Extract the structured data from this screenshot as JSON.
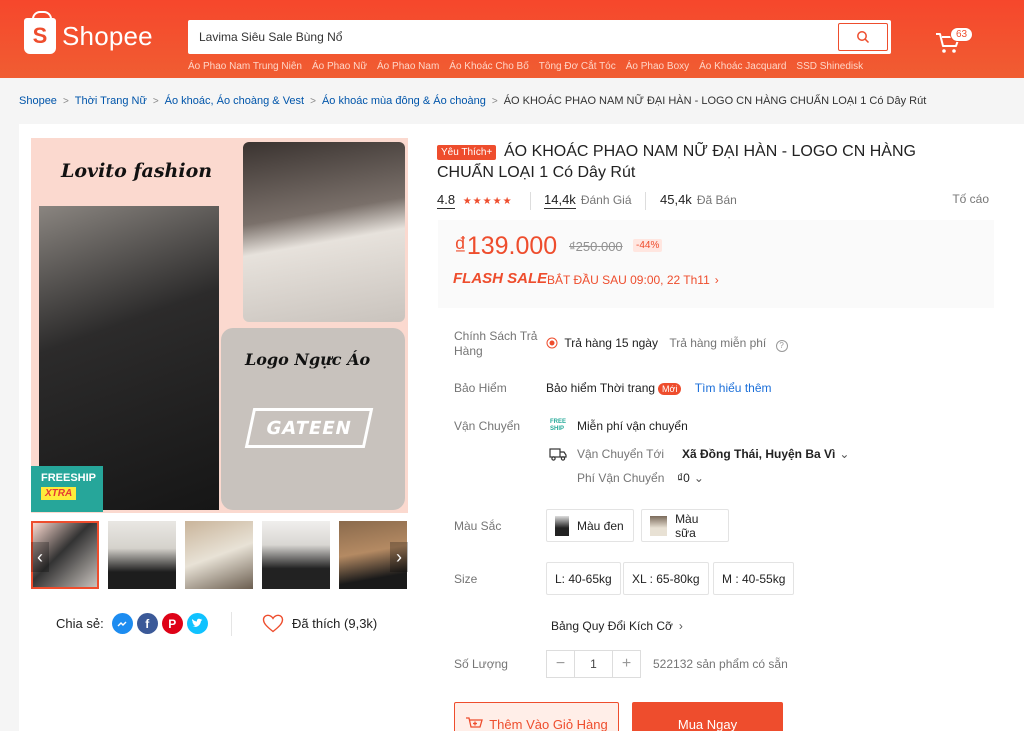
{
  "header": {
    "logo_text": "Shopee",
    "logo_mark": "S",
    "search_value": "Lavima Siêu Sale Bùng Nổ",
    "suggestions": [
      "Áo Phao Nam Trung Niên",
      "Áo Phao Nữ",
      "Áo Phao Nam",
      "Áo Khoác Cho Bố",
      "Tông Đơ Cắt Tóc",
      "Áo Phao Boxy",
      "Áo Khoác Jacquard",
      "SSD Shinedisk"
    ],
    "cart_count": "63",
    "brand_color": "#ee4d2d"
  },
  "breadcrumb": {
    "items": [
      "Shopee",
      "Thời Trang Nữ",
      "Áo khoác, Áo choàng & Vest",
      "Áo khoác mùa đông & Áo choàng"
    ],
    "current": "ÁO KHOÁC PHAO NAM NỮ ĐẠI HÀN - LOGO CN HÀNG CHUẨN LOẠI 1 Có Dây Rút"
  },
  "gallery": {
    "main_title": "Lovito fashion",
    "logo_title": "Logo Ngực Áo",
    "logo_box": "GATEEN",
    "freeship": "FREESHIP",
    "freeship_xtra": "XTRA"
  },
  "share": {
    "label": "Chia sẻ:",
    "icons": [
      "messenger-icon",
      "facebook-icon",
      "pinterest-icon",
      "twitter-icon"
    ],
    "liked": "Đã thích (9,3k)"
  },
  "product": {
    "badge": "Yêu Thích+",
    "title": "ÁO KHOÁC PHAO NAM NỮ ĐẠI HÀN - LOGO CN HÀNG CHUẨN LOẠI 1 Có Dây Rút",
    "rating": "4.8",
    "stars": "★★★★★",
    "reviews_count": "14,4k",
    "reviews_label": "Đánh Giá",
    "sold_count": "45,4k",
    "sold_label": "Đã Bán",
    "report": "Tố cáo",
    "price": "₫139.000",
    "old_price": "₫250.000",
    "discount": "-44%",
    "flash_sale": "FLASH SALE",
    "flash_time": "BẮT ĐẦU SAU 09:00, 22 Th11"
  },
  "details": {
    "return_label": "Chính Sách Trả Hàng",
    "return_value": "Trả hàng 15 ngày",
    "return_free": "Trả hàng miễn phí",
    "insurance_label": "Bảo Hiểm",
    "insurance_value": "Bảo hiểm Thời trang",
    "insurance_badge": "Mới",
    "insurance_link": "Tìm hiểu thêm",
    "shipping_label": "Vận Chuyển",
    "free_ship": "Miễn phí vận chuyển",
    "ship_to_label": "Vận Chuyển Tới",
    "ship_to_value": "Xã Đồng Thái, Huyện Ba Vì",
    "ship_fee_label": "Phí Vận Chuyển",
    "ship_fee_value": "₫0",
    "color_label": "Màu Sắc",
    "colors": [
      "Màu đen",
      "Màu sữa"
    ],
    "size_label": "Size",
    "sizes": [
      "L: 40-65kg",
      "XL : 65-80kg",
      "M : 40-55kg"
    ],
    "size_chart": "Bảng Quy Đổi Kích Cỡ",
    "qty_label": "Số Lượng",
    "qty_value": "1",
    "qty_minus": "−",
    "qty_plus": "+",
    "stock": "522132 sản phẩm có sẵn",
    "add_to_cart": "Thêm Vào Giỏ Hàng",
    "buy_now": "Mua Ngay"
  }
}
